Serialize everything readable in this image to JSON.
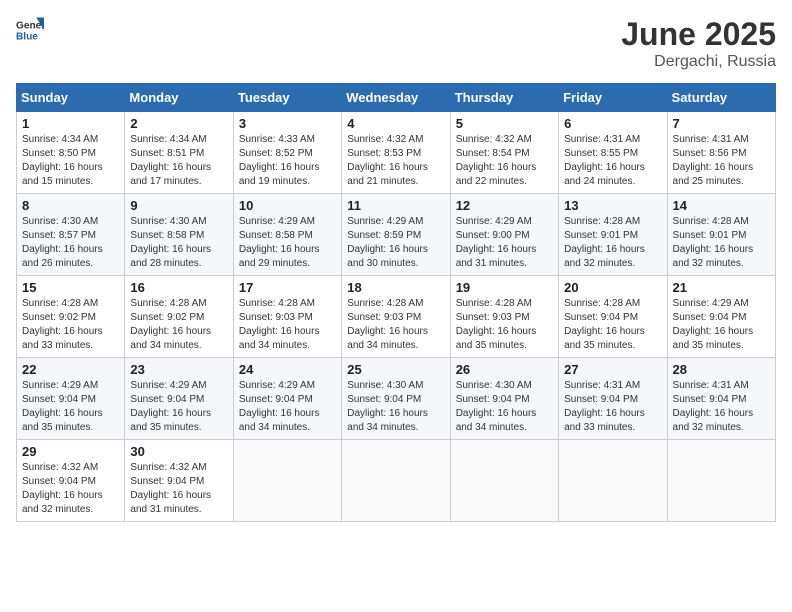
{
  "header": {
    "logo_general": "General",
    "logo_blue": "Blue",
    "title": "June 2025",
    "location": "Dergachi, Russia"
  },
  "calendar": {
    "days_of_week": [
      "Sunday",
      "Monday",
      "Tuesday",
      "Wednesday",
      "Thursday",
      "Friday",
      "Saturday"
    ],
    "weeks": [
      [
        {
          "day": "1",
          "info": "Sunrise: 4:34 AM\nSunset: 8:50 PM\nDaylight: 16 hours\nand 15 minutes."
        },
        {
          "day": "2",
          "info": "Sunrise: 4:34 AM\nSunset: 8:51 PM\nDaylight: 16 hours\nand 17 minutes."
        },
        {
          "day": "3",
          "info": "Sunrise: 4:33 AM\nSunset: 8:52 PM\nDaylight: 16 hours\nand 19 minutes."
        },
        {
          "day": "4",
          "info": "Sunrise: 4:32 AM\nSunset: 8:53 PM\nDaylight: 16 hours\nand 21 minutes."
        },
        {
          "day": "5",
          "info": "Sunrise: 4:32 AM\nSunset: 8:54 PM\nDaylight: 16 hours\nand 22 minutes."
        },
        {
          "day": "6",
          "info": "Sunrise: 4:31 AM\nSunset: 8:55 PM\nDaylight: 16 hours\nand 24 minutes."
        },
        {
          "day": "7",
          "info": "Sunrise: 4:31 AM\nSunset: 8:56 PM\nDaylight: 16 hours\nand 25 minutes."
        }
      ],
      [
        {
          "day": "8",
          "info": "Sunrise: 4:30 AM\nSunset: 8:57 PM\nDaylight: 16 hours\nand 26 minutes."
        },
        {
          "day": "9",
          "info": "Sunrise: 4:30 AM\nSunset: 8:58 PM\nDaylight: 16 hours\nand 28 minutes."
        },
        {
          "day": "10",
          "info": "Sunrise: 4:29 AM\nSunset: 8:58 PM\nDaylight: 16 hours\nand 29 minutes."
        },
        {
          "day": "11",
          "info": "Sunrise: 4:29 AM\nSunset: 8:59 PM\nDaylight: 16 hours\nand 30 minutes."
        },
        {
          "day": "12",
          "info": "Sunrise: 4:29 AM\nSunset: 9:00 PM\nDaylight: 16 hours\nand 31 minutes."
        },
        {
          "day": "13",
          "info": "Sunrise: 4:28 AM\nSunset: 9:01 PM\nDaylight: 16 hours\nand 32 minutes."
        },
        {
          "day": "14",
          "info": "Sunrise: 4:28 AM\nSunset: 9:01 PM\nDaylight: 16 hours\nand 32 minutes."
        }
      ],
      [
        {
          "day": "15",
          "info": "Sunrise: 4:28 AM\nSunset: 9:02 PM\nDaylight: 16 hours\nand 33 minutes."
        },
        {
          "day": "16",
          "info": "Sunrise: 4:28 AM\nSunset: 9:02 PM\nDaylight: 16 hours\nand 34 minutes."
        },
        {
          "day": "17",
          "info": "Sunrise: 4:28 AM\nSunset: 9:03 PM\nDaylight: 16 hours\nand 34 minutes."
        },
        {
          "day": "18",
          "info": "Sunrise: 4:28 AM\nSunset: 9:03 PM\nDaylight: 16 hours\nand 34 minutes."
        },
        {
          "day": "19",
          "info": "Sunrise: 4:28 AM\nSunset: 9:03 PM\nDaylight: 16 hours\nand 35 minutes."
        },
        {
          "day": "20",
          "info": "Sunrise: 4:28 AM\nSunset: 9:04 PM\nDaylight: 16 hours\nand 35 minutes."
        },
        {
          "day": "21",
          "info": "Sunrise: 4:29 AM\nSunset: 9:04 PM\nDaylight: 16 hours\nand 35 minutes."
        }
      ],
      [
        {
          "day": "22",
          "info": "Sunrise: 4:29 AM\nSunset: 9:04 PM\nDaylight: 16 hours\nand 35 minutes."
        },
        {
          "day": "23",
          "info": "Sunrise: 4:29 AM\nSunset: 9:04 PM\nDaylight: 16 hours\nand 35 minutes."
        },
        {
          "day": "24",
          "info": "Sunrise: 4:29 AM\nSunset: 9:04 PM\nDaylight: 16 hours\nand 34 minutes."
        },
        {
          "day": "25",
          "info": "Sunrise: 4:30 AM\nSunset: 9:04 PM\nDaylight: 16 hours\nand 34 minutes."
        },
        {
          "day": "26",
          "info": "Sunrise: 4:30 AM\nSunset: 9:04 PM\nDaylight: 16 hours\nand 34 minutes."
        },
        {
          "day": "27",
          "info": "Sunrise: 4:31 AM\nSunset: 9:04 PM\nDaylight: 16 hours\nand 33 minutes."
        },
        {
          "day": "28",
          "info": "Sunrise: 4:31 AM\nSunset: 9:04 PM\nDaylight: 16 hours\nand 32 minutes."
        }
      ],
      [
        {
          "day": "29",
          "info": "Sunrise: 4:32 AM\nSunset: 9:04 PM\nDaylight: 16 hours\nand 32 minutes."
        },
        {
          "day": "30",
          "info": "Sunrise: 4:32 AM\nSunset: 9:04 PM\nDaylight: 16 hours\nand 31 minutes."
        },
        {
          "day": "",
          "info": ""
        },
        {
          "day": "",
          "info": ""
        },
        {
          "day": "",
          "info": ""
        },
        {
          "day": "",
          "info": ""
        },
        {
          "day": "",
          "info": ""
        }
      ]
    ]
  }
}
